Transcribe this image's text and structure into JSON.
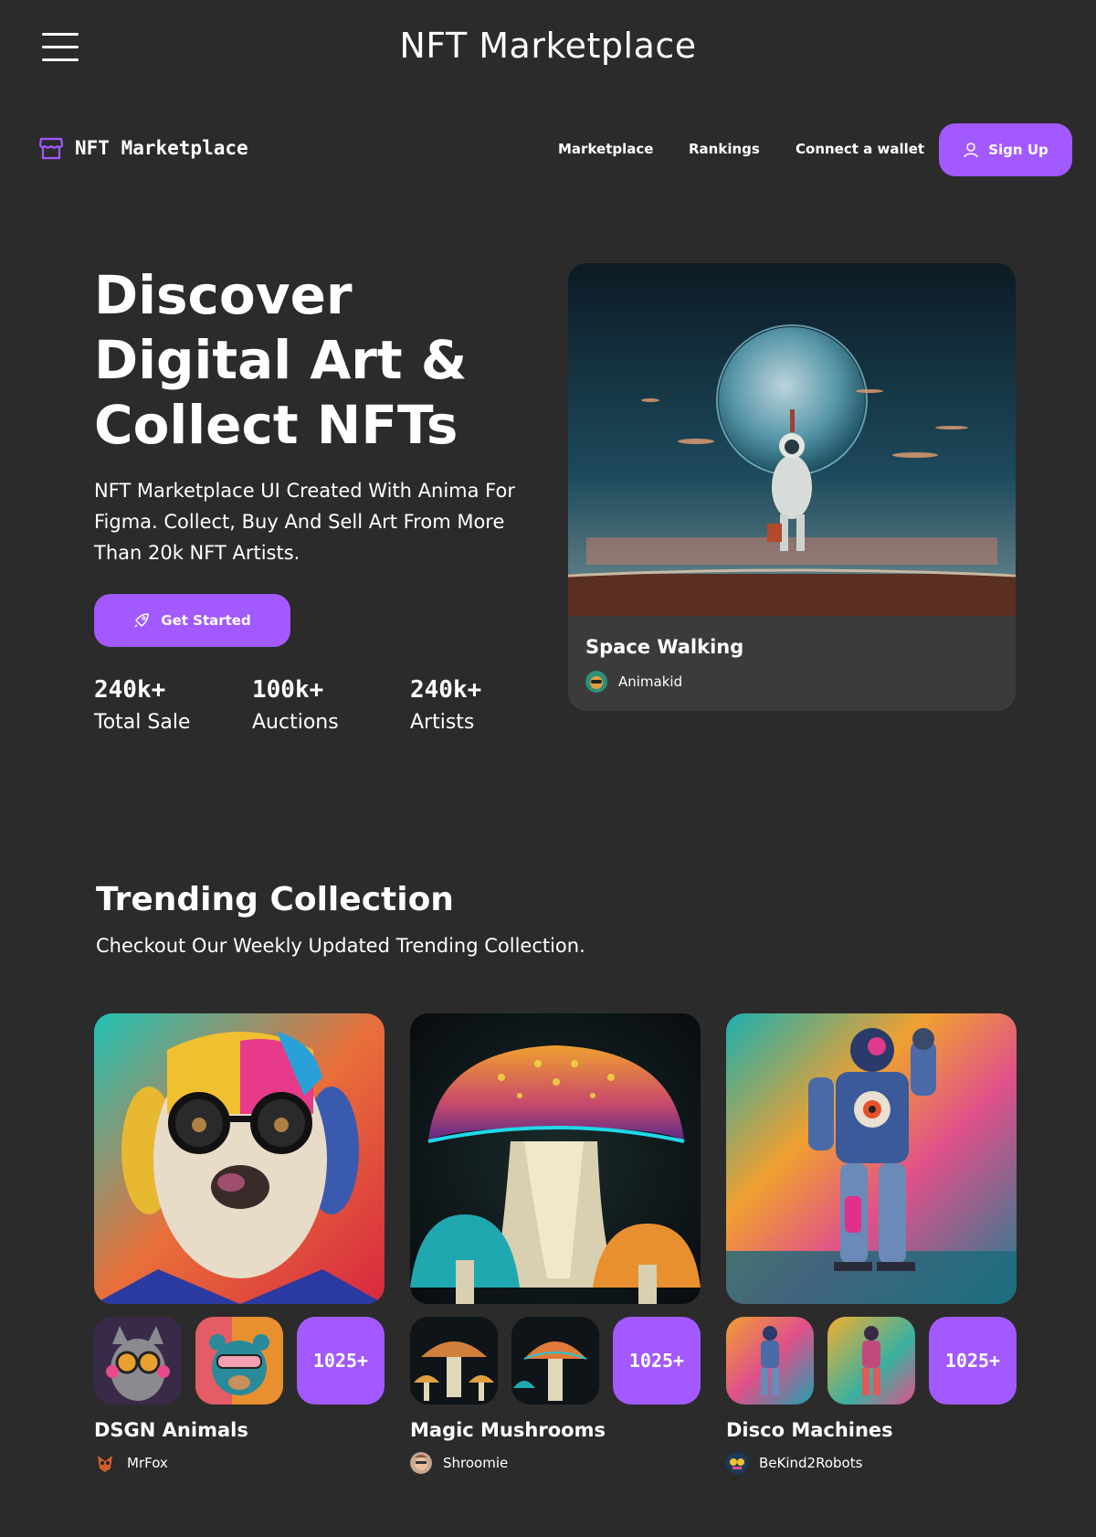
{
  "top_bar": {
    "title": "NFT Marketplace",
    "menu_icon": "hamburger-icon"
  },
  "nav": {
    "logo_text": "NFT Marketplace",
    "logo_icon": "storefront-icon",
    "links": [
      "Marketplace",
      "Rankings",
      "Connect a wallet"
    ],
    "signup_label": "Sign Up",
    "signup_icon": "user-icon"
  },
  "colors": {
    "background": "#2b2b2b",
    "accent": "#a259ff",
    "card": "#3b3b3b",
    "text": "#ffffff"
  },
  "hero": {
    "title_lines": [
      "Discover",
      "Digital Art &",
      "Collect NFTs"
    ],
    "subtitle": "NFT Marketplace UI Created With Anima For Figma. Collect, Buy And Sell Art From More Than 20k NFT Artists.",
    "cta_label": "Get Started",
    "cta_icon": "rocket-icon",
    "stats": [
      {
        "value": "240k+",
        "label": "Total Sale"
      },
      {
        "value": "100k+",
        "label": "Auctions"
      },
      {
        "value": "240k+",
        "label": "Artists"
      }
    ],
    "featured": {
      "title": "Space Walking",
      "artist": "Animakid"
    }
  },
  "trending": {
    "title": "Trending Collection",
    "subtitle": "Checkout Our Weekly Updated Trending Collection.",
    "collections": [
      {
        "name": "DSGN Animals",
        "artist": "MrFox",
        "count": "1025+"
      },
      {
        "name": "Magic Mushrooms",
        "artist": "Shroomie",
        "count": "1025+"
      },
      {
        "name": "Disco Machines",
        "artist": "BeKind2Robots",
        "count": "1025+"
      }
    ]
  }
}
